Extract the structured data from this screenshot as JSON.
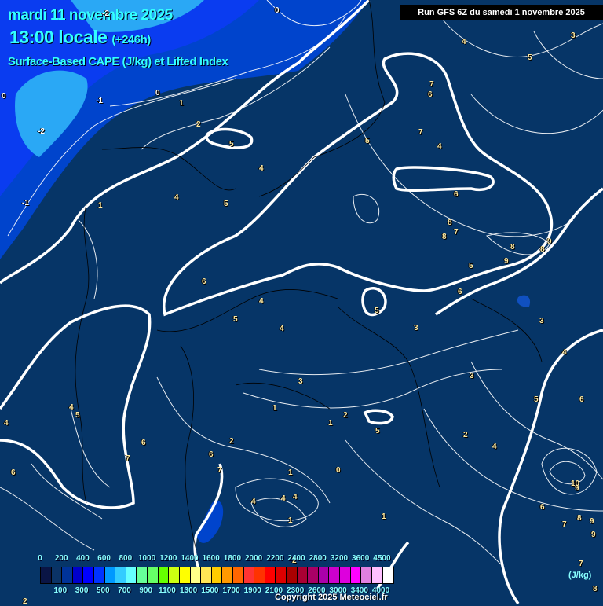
{
  "header": {
    "date": "mardi 11 novembre 2025",
    "time": "13:00 locale",
    "lead": "(+246h)",
    "parameter": "Surface-Based CAPE (J/kg) et Lifted Index",
    "run": "Run GFS 6Z du samedi 1 novembre 2025"
  },
  "map": {
    "background_color": "#063567",
    "contour_labels": [
      "0",
      "-2",
      "0",
      "-1",
      "-2",
      "-1",
      "0",
      "1",
      "2",
      "5",
      "4",
      "4",
      "5",
      "1",
      "6",
      "5",
      "4",
      "4",
      "5",
      "3",
      "3",
      "1",
      "1",
      "2",
      "5",
      "2",
      "6",
      "7",
      "1",
      "0",
      "4",
      "1",
      "4",
      "4",
      "6",
      "4",
      "5",
      "4",
      "6",
      "7",
      "6",
      "7",
      "7",
      "5",
      "4",
      "6",
      "8",
      "7",
      "8",
      "8",
      "9",
      "9",
      "8",
      "5",
      "6",
      "3",
      "4",
      "5",
      "6",
      "10",
      "9",
      "6",
      "7",
      "8",
      "9",
      "9",
      "3",
      "4",
      "4",
      "3",
      "5",
      "2",
      "1",
      "8",
      "7",
      "2",
      "2"
    ]
  },
  "legend": {
    "unit": "(J/kg)",
    "top_ticks": [
      "0",
      "200",
      "400",
      "600",
      "800",
      "1000",
      "1200",
      "1400",
      "1600",
      "1800",
      "2000",
      "2200",
      "2400",
      "2800",
      "3200",
      "3600",
      "4500"
    ],
    "bottom_ticks": [
      "100",
      "300",
      "500",
      "700",
      "900",
      "1100",
      "1300",
      "1500",
      "1700",
      "1900",
      "2100",
      "2300",
      "2600",
      "3000",
      "3400",
      "4000"
    ],
    "colors": [
      "#0a1545",
      "#0b3366",
      "#003399",
      "#0000cc",
      "#0000ff",
      "#0033ff",
      "#0099ff",
      "#33ccff",
      "#66ffff",
      "#66ff99",
      "#66ff66",
      "#66ff00",
      "#ccff11",
      "#ffff00",
      "#ffff88",
      "#ffe655",
      "#ffcc00",
      "#ff9900",
      "#ff6600",
      "#ff3333",
      "#ff3300",
      "#ff0000",
      "#dd0000",
      "#aa0000",
      "#aa0033",
      "#aa0066",
      "#aa00aa",
      "#cc00cc",
      "#dd00dd",
      "#ff00ff",
      "#e080e0",
      "#ffc0ff",
      "#ffffff"
    ]
  },
  "copyright": "Copyright 2025 Meteociel.fr"
}
